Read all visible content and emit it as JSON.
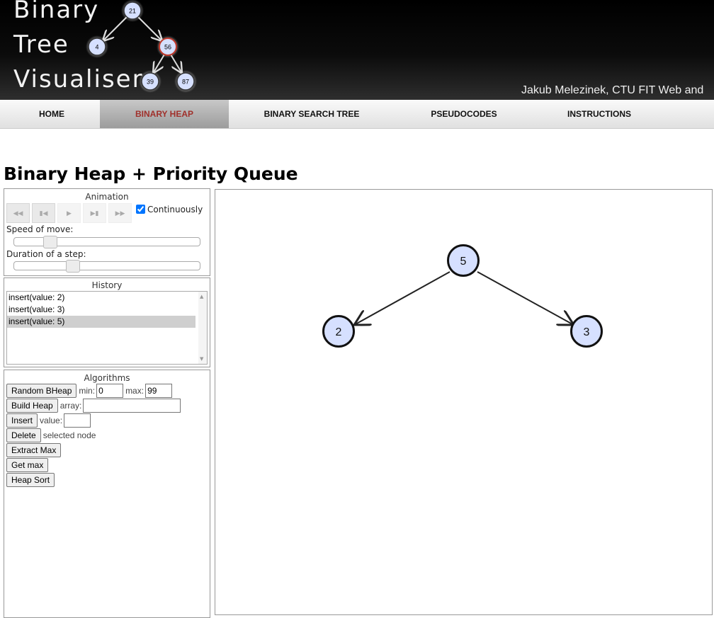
{
  "header": {
    "logo_lines": [
      "Binary",
      "Tree",
      "Visualiser"
    ],
    "logo_nodes": [
      "21",
      "4",
      "56",
      "39",
      "87"
    ],
    "tagline": "Jakub Melezinek, CTU FIT Web and"
  },
  "nav": {
    "items": [
      "HOME",
      "BINARY HEAP",
      "BINARY SEARCH TREE",
      "PSEUDOCODES",
      "INSTRUCTIONS"
    ],
    "active": "BINARY HEAP"
  },
  "page_title": "Binary Heap + Priority Queue",
  "animation": {
    "title": "Animation",
    "controls": [
      "rewind-icon",
      "step-back-icon",
      "play-icon",
      "step-forward-icon",
      "fast-forward-icon"
    ],
    "continuously_label": "Continuously",
    "continuously_checked": true,
    "speed_label": "Speed of move:",
    "speed_value": 0.17,
    "duration_label": "Duration of a step:",
    "duration_value": 0.3
  },
  "history": {
    "title": "History",
    "items": [
      "insert(value: 2)",
      "insert(value: 3)",
      "insert(value: 5)"
    ],
    "selected_index": 2
  },
  "algorithms": {
    "title": "Algorithms",
    "random_label": "Random BHeap",
    "min_label": "min:",
    "min_value": "0",
    "max_label": "max:",
    "max_value": "99",
    "build_label": "Build Heap",
    "array_label": "array:",
    "array_value": "",
    "insert_label": "Insert",
    "value_label": "value:",
    "value_value": "",
    "delete_label": "Delete",
    "delete_note": "selected node",
    "extract_label": "Extract Max",
    "getmax_label": "Get max",
    "heapsort_label": "Heap Sort"
  },
  "heap": {
    "root": "5",
    "left": "2",
    "right": "3",
    "node_fill": "#d6e0ff"
  },
  "colors": {
    "header_bg": "#000000",
    "nav_active_text": "#a0302b",
    "logo_highlight_ring": "#c0392b"
  }
}
